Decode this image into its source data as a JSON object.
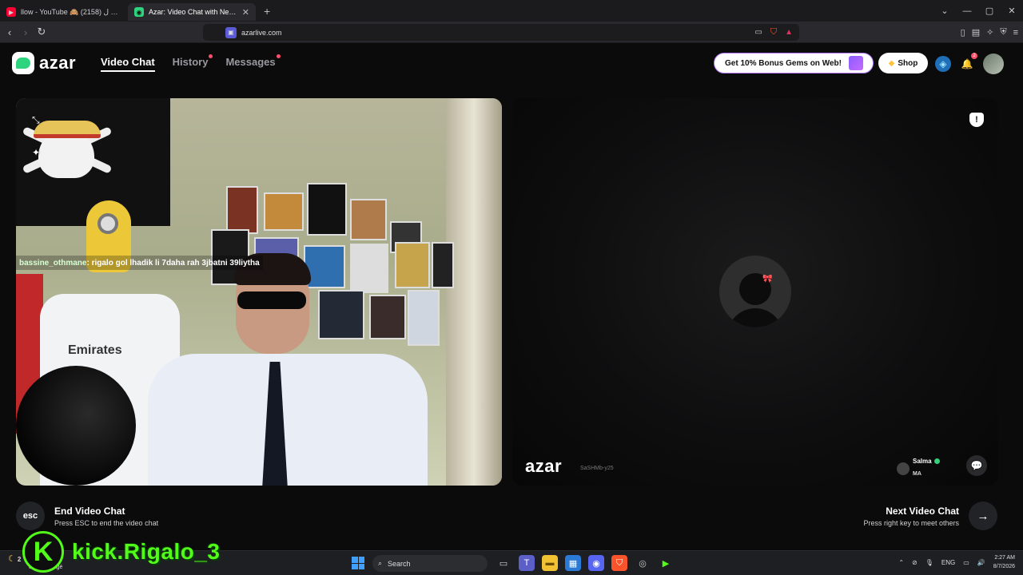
{
  "browser": {
    "tabs": [
      {
        "title": "llow - YouTube 🙈 اش واقع ل (2158)",
        "active": false
      },
      {
        "title": "Azar: Video Chat with New Pe",
        "active": true
      }
    ],
    "new_tab": "+",
    "url": "azarlive.com"
  },
  "app": {
    "logo_text": "azar",
    "nav": [
      {
        "label": "Video Chat",
        "active": true
      },
      {
        "label": "History",
        "dot": true
      },
      {
        "label": "Messages",
        "dot": true
      }
    ],
    "promo_label": "Get 10% Bonus Gems on Web!",
    "shop_label": "Shop",
    "notification_count": "2"
  },
  "left_video": {
    "chat_username": "bassine_othmane",
    "chat_message": " : rigalo gol lhadik li 7daha rah 3jbatni 39liytha",
    "jersey_text": "Emirates"
  },
  "right_video": {
    "watermark": "azar",
    "watermark_id": "SaSHMb-y25",
    "peer_name": "Salma",
    "peer_country": "MA"
  },
  "actions": {
    "end_key": "esc",
    "end_title": "End Video Chat",
    "end_sub": "Press ESC to end the video chat",
    "next_title": "Next Video Chat",
    "next_sub": "Press right key to meet others"
  },
  "overlay": {
    "kick_logo": "K",
    "kick_name": "kick.Rigalo_3"
  },
  "taskbar": {
    "weather_temp": "2",
    "weather_text": "emps dégagé",
    "search_placeholder": "Search",
    "lang": "ENG",
    "time": "2:27 AM",
    "date": "8/7/2026"
  },
  "colors": {
    "accent_green": "#2fd47f",
    "kick_green": "#53fc18",
    "dot_red": "#ff4d6a"
  }
}
